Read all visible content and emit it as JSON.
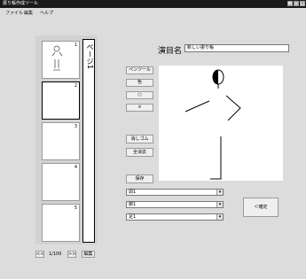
{
  "window": {
    "title": "振り帳作成ツール",
    "controls": [
      "_",
      "□",
      "×"
    ]
  },
  "menu": [
    "ファイル",
    "編集",
    "ヘルプ"
  ],
  "thumbnails": [
    {
      "num": "1"
    },
    {
      "num": "2"
    },
    {
      "num": "3"
    },
    {
      "num": "4"
    },
    {
      "num": "5"
    }
  ],
  "page_strip": {
    "text": "ページ1"
  },
  "title_label": "演目名",
  "title_input": "新しい振り帳",
  "tools": {
    "pencil": "ペンツール",
    "color": "色",
    "circle": "○",
    "cross": "×",
    "erase": "消しゴム",
    "clear_all": "全消去",
    "save": "保存"
  },
  "selects": [
    "頭1",
    "腕1",
    "足1"
  ],
  "confirm_button": "＜確定",
  "pagination": {
    "prev": "<<",
    "page": "1/100",
    "next": ">>",
    "edit": "編集"
  }
}
